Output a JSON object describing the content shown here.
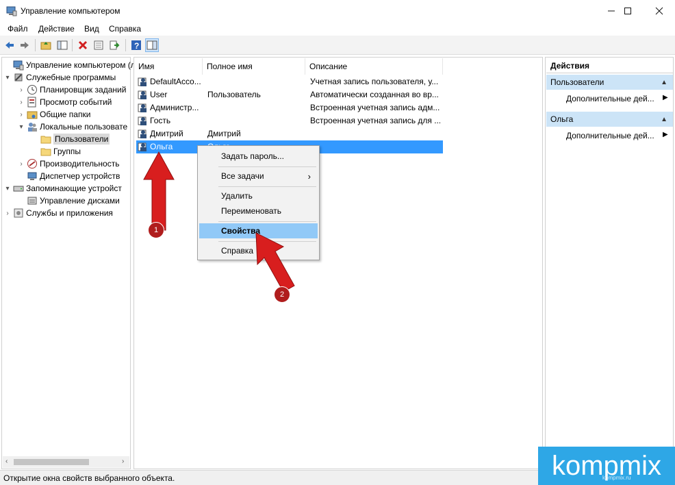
{
  "window": {
    "title": "Управление компьютером",
    "controls": {
      "minimize": "—",
      "maximize": "☐",
      "close": "✕"
    }
  },
  "menu": [
    "Файл",
    "Действие",
    "Вид",
    "Справка"
  ],
  "toolbar_icons": [
    "back-icon",
    "forward-icon",
    "up-folder-icon",
    "show-hide-tree-icon",
    "delete-icon",
    "properties-icon",
    "export-icon",
    "help-icon",
    "view-icon"
  ],
  "tree": [
    {
      "label": "Управление компьютером (л",
      "expander": "",
      "icon": "computer-icon"
    },
    {
      "label": "Служебные программы",
      "expander": "▾",
      "icon": "tools-icon"
    },
    {
      "label": "Планировщик заданий",
      "expander": "›",
      "icon": "clock-icon"
    },
    {
      "label": "Просмотр событий",
      "expander": "›",
      "icon": "event-viewer-icon"
    },
    {
      "label": "Общие папки",
      "expander": "›",
      "icon": "shared-folder-icon"
    },
    {
      "label": "Локальные пользовате",
      "expander": "▾",
      "icon": "users-icon"
    },
    {
      "label": "Пользователи",
      "expander": "",
      "icon": "folder-icon"
    },
    {
      "label": "Группы",
      "expander": "",
      "icon": "folder-icon"
    },
    {
      "label": "Производительность",
      "expander": "›",
      "icon": "performance-icon"
    },
    {
      "label": "Диспетчер устройств",
      "expander": "",
      "icon": "device-manager-icon"
    },
    {
      "label": "Запоминающие устройст",
      "expander": "▾",
      "icon": "storage-icon"
    },
    {
      "label": "Управление дисками",
      "expander": "",
      "icon": "disk-icon"
    },
    {
      "label": "Службы и приложения",
      "expander": "›",
      "icon": "services-icon"
    }
  ],
  "list": {
    "columns": [
      "Имя",
      "Полное имя",
      "Описание"
    ],
    "rows": [
      {
        "name": "DefaultAcco...",
        "full_name": "",
        "description": "Учетная запись пользователя, у..."
      },
      {
        "name": "User",
        "full_name": "Пользователь",
        "description": "Автоматически созданная во вр..."
      },
      {
        "name": "Администр...",
        "full_name": "",
        "description": "Встроенная учетная запись адм..."
      },
      {
        "name": "Гость",
        "full_name": "",
        "description": "Встроенная учетная запись для ..."
      },
      {
        "name": "Дмитрий",
        "full_name": "Дмитрий",
        "description": ""
      },
      {
        "name": "Ольга",
        "full_name": "Ольга",
        "description": ""
      }
    ],
    "selected_row": "Ольга"
  },
  "context_menu": {
    "items": [
      "Задать пароль...",
      "Все задачи",
      "Удалить",
      "Переименовать",
      "Свойства",
      "Справка"
    ],
    "submenu_arrow": "›",
    "highlighted": "Свойства"
  },
  "actions": {
    "title": "Действия",
    "sections": [
      {
        "header": "Пользователи",
        "item": "Дополнительные дей..."
      },
      {
        "header": "Ольга",
        "item": "Дополнительные дей..."
      }
    ],
    "collapse_glyph": "▲",
    "more_glyph": "▶"
  },
  "status": "Открытие окна свойств выбранного объекта.",
  "annotations": {
    "step1": "1",
    "step2": "2"
  },
  "watermark": {
    "text": "kompmix",
    "sub": "kompmix.ru"
  },
  "colors": {
    "selection": "#3399ff",
    "menu_highlight": "#91c9f7",
    "arrow_red": "#d81e1e",
    "section_header": "#cce4f7",
    "watermark": "#2ea7e6"
  }
}
